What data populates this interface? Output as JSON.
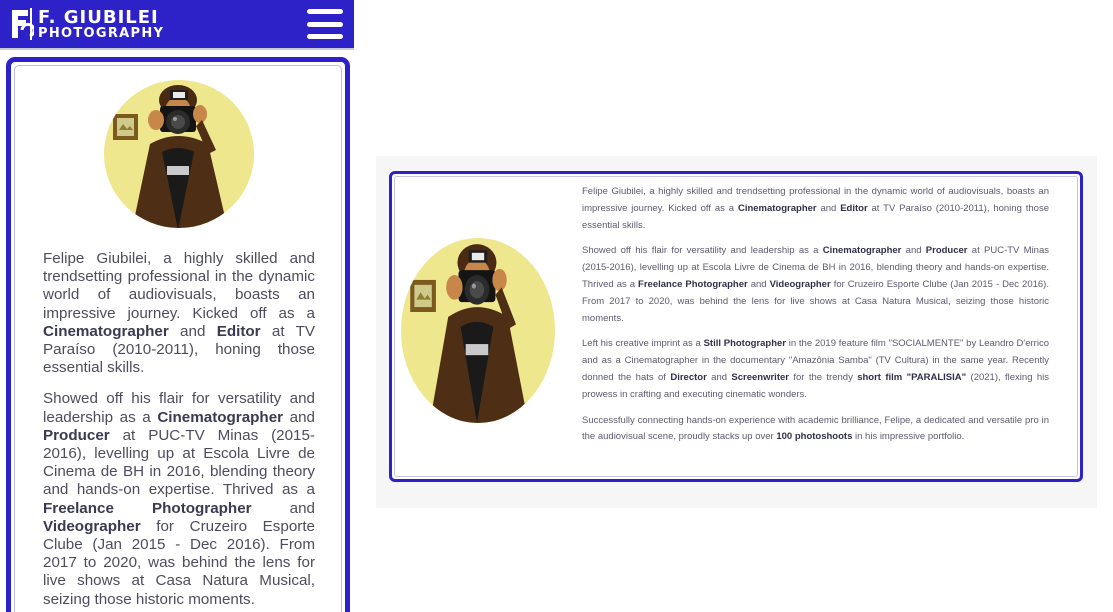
{
  "brand": {
    "name_line1": "F. GIUBILEI",
    "name_line2": "PHOTOGRAPHY",
    "header_color": "#2d22c7"
  },
  "icons": {
    "logo": "camera-logo-icon",
    "menu": "hamburger-menu-icon"
  },
  "bio": {
    "p1": {
      "t1": "Felipe Giubilei, a highly skilled and trendsetting professional in the dynamic world of audiovisuals, boasts an impressive journey. Kicked off as a ",
      "b1": "Cinematographer",
      "t2": " and ",
      "b2": "Editor",
      "t3": " at TV Paraíso (2010-2011), honing those essential skills."
    },
    "p2": {
      "t1": "Showed off his flair for versatility and leadership as a ",
      "b1": "Cinematographer",
      "t2": " and ",
      "b2": "Producer",
      "t3": " at PUC-TV Minas (2015-2016), levelling up at Escola Livre de Cinema de BH in 2016, blending theory and hands-on expertise. Thrived as a ",
      "b3": "Freelance Photographer",
      "t4": " and ",
      "b4": "Videographer",
      "t5": " for Cruzeiro Esporte Clube (Jan 2015 - Dec 2016). From 2017 to 2020, was behind the lens for live shows at Casa Natura Musical, seizing those historic moments."
    },
    "p3": {
      "t1": "Left his creative imprint as a ",
      "b1": "Still Photographer",
      "t2": " in the 2019 feature film \"SOCIALMENTE\" by Leandro D'errico and as a Cinematographer in the documentary \"Amazônia Samba\" (TV Cultura) in the same year. Recently donned the hats of ",
      "b2": "Director",
      "t3": " and ",
      "b3": "Screenwriter",
      "t4": " for the trendy ",
      "b4": "short film \"PARALISIA\"",
      "t5": " (2021), flexing his prowess in crafting and executing cinematic wonders."
    },
    "p4": {
      "t1": "Successfully connecting hands-on experience with academic brilliance, Felipe, a dedicated and versatile pro in the audiovisual scene, proudly stacks up over ",
      "b1": "100 photoshoots",
      "t2": " in his impressive portfolio."
    }
  }
}
